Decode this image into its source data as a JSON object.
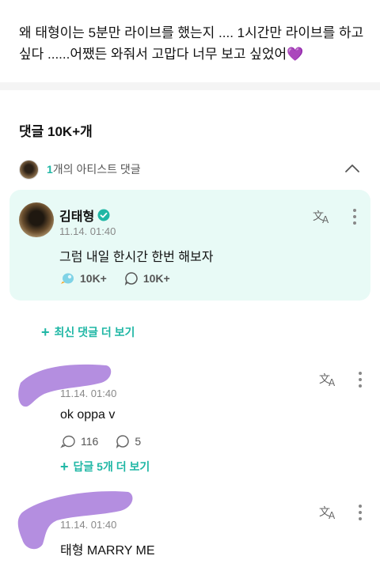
{
  "post": {
    "text": "왜 태형이는 5분만 라이브를 했는지 .... 1시간만 라이브를 하고 싶다 ......어쨌든 와줘서 고맙다 너무 보고 싶었어",
    "emoji": "💜"
  },
  "comments_header": {
    "title": "댓글 10K+개"
  },
  "artist_comments_bar": {
    "count": "1",
    "label": "개의 아티스트 댓글"
  },
  "artist_comment": {
    "name": "김태형",
    "time": "11.14. 01:40",
    "body": "그럼 내일 한시간 한번 해보자",
    "likes": "10K+",
    "replies": "10K+",
    "translate_label": "文A"
  },
  "more_latest": {
    "label": "최신 댓글 더 보기"
  },
  "comments": [
    {
      "time": "11.14. 01:40",
      "body": "ok oppa v",
      "likes": "116",
      "replies": "5",
      "replies_link": "답글 5개 더 보기"
    },
    {
      "time": "11.14. 01:40",
      "body": "태형 MARRY ME"
    }
  ],
  "colors": {
    "accent": "#20b7a5",
    "artist_card_bg": "#e8faf6",
    "scribble": "#b48ee0"
  }
}
